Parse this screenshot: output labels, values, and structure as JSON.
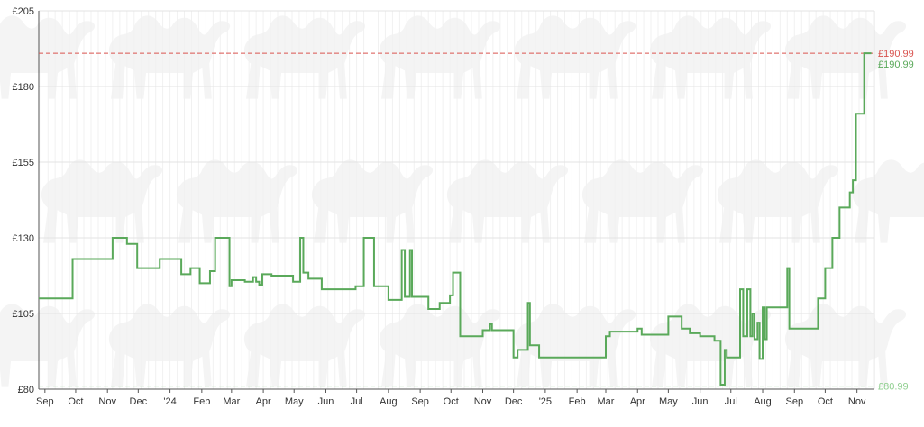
{
  "colors": {
    "series": "#5aa95a",
    "high_ref": "#d9534f",
    "low_ref": "#8fcf8f",
    "grid": "#e3e3e3",
    "axis": "#555555",
    "watermark": "#f4f4f4"
  },
  "watermark_icon": "camel-icon",
  "chart_data": {
    "type": "line",
    "title": "",
    "xlabel": "",
    "ylabel": "",
    "ylim": [
      80,
      205
    ],
    "xlim": [
      "2023-08-26",
      "2025-11-18"
    ],
    "grid": true,
    "legend": "none",
    "y_ticks": [
      {
        "value": 80,
        "label": "£80"
      },
      {
        "value": 105,
        "label": "£105"
      },
      {
        "value": 130,
        "label": "£130"
      },
      {
        "value": 155,
        "label": "£155"
      },
      {
        "value": 180,
        "label": "£180"
      },
      {
        "value": 205,
        "label": "£205"
      }
    ],
    "x_ticks": [
      {
        "date": "2023-09-01",
        "label": "Sep"
      },
      {
        "date": "2023-10-01",
        "label": "Oct"
      },
      {
        "date": "2023-11-01",
        "label": "Nov"
      },
      {
        "date": "2023-12-01",
        "label": "Dec"
      },
      {
        "date": "2024-01-01",
        "label": "'24"
      },
      {
        "date": "2024-02-01",
        "label": "Feb"
      },
      {
        "date": "2024-03-01",
        "label": "Mar"
      },
      {
        "date": "2024-04-01",
        "label": "Apr"
      },
      {
        "date": "2024-05-01",
        "label": "May"
      },
      {
        "date": "2024-06-01",
        "label": "Jun"
      },
      {
        "date": "2024-07-01",
        "label": "Jul"
      },
      {
        "date": "2024-08-01",
        "label": "Aug"
      },
      {
        "date": "2024-09-01",
        "label": "Sep"
      },
      {
        "date": "2024-10-01",
        "label": "Oct"
      },
      {
        "date": "2024-11-01",
        "label": "Nov"
      },
      {
        "date": "2024-12-01",
        "label": "Dec"
      },
      {
        "date": "2025-01-01",
        "label": "'25"
      },
      {
        "date": "2025-02-01",
        "label": "Feb"
      },
      {
        "date": "2025-03-01",
        "label": "Mar"
      },
      {
        "date": "2025-04-01",
        "label": "Apr"
      },
      {
        "date": "2025-05-01",
        "label": "May"
      },
      {
        "date": "2025-06-01",
        "label": "Jun"
      },
      {
        "date": "2025-07-01",
        "label": "Jul"
      },
      {
        "date": "2025-08-01",
        "label": "Aug"
      },
      {
        "date": "2025-09-01",
        "label": "Sep"
      },
      {
        "date": "2025-10-01",
        "label": "Oct"
      },
      {
        "date": "2025-11-01",
        "label": "Nov"
      }
    ],
    "reference_lines": [
      {
        "value": 190.99,
        "label": "£190.99",
        "color": "#d9534f",
        "style": "dashed"
      },
      {
        "value": 80.99,
        "label": "£80.99",
        "color": "#8fcf8f",
        "style": "dashed"
      }
    ],
    "current_label": {
      "value": 190.99,
      "label": "£190.99",
      "color": "#5aa95a"
    },
    "series": [
      {
        "step": true,
        "points": [
          [
            "2023-08-26",
            110
          ],
          [
            "2023-09-28",
            110
          ],
          [
            "2023-09-28",
            123
          ],
          [
            "2023-11-06",
            123
          ],
          [
            "2023-11-06",
            130
          ],
          [
            "2023-11-20",
            130
          ],
          [
            "2023-11-20",
            128
          ],
          [
            "2023-11-30",
            128
          ],
          [
            "2023-11-30",
            120
          ],
          [
            "2023-12-22",
            120
          ],
          [
            "2023-12-22",
            123
          ],
          [
            "2024-01-12",
            123
          ],
          [
            "2024-01-12",
            118
          ],
          [
            "2024-01-21",
            118
          ],
          [
            "2024-01-21",
            120
          ],
          [
            "2024-01-30",
            120
          ],
          [
            "2024-01-30",
            115
          ],
          [
            "2024-02-09",
            115
          ],
          [
            "2024-02-09",
            119
          ],
          [
            "2024-02-14",
            119
          ],
          [
            "2024-02-14",
            130
          ],
          [
            "2024-02-28",
            130
          ],
          [
            "2024-02-28",
            114
          ],
          [
            "2024-03-01",
            114
          ],
          [
            "2024-03-01",
            116
          ],
          [
            "2024-03-14",
            116
          ],
          [
            "2024-03-14",
            115.5
          ],
          [
            "2024-03-22",
            115.5
          ],
          [
            "2024-03-22",
            117
          ],
          [
            "2024-03-25",
            117
          ],
          [
            "2024-03-25",
            115.5
          ],
          [
            "2024-03-28",
            115.5
          ],
          [
            "2024-03-28",
            114.5
          ],
          [
            "2024-03-31",
            114.5
          ],
          [
            "2024-03-31",
            118
          ],
          [
            "2024-04-09",
            118
          ],
          [
            "2024-04-09",
            117.5
          ],
          [
            "2024-04-30",
            117.5
          ],
          [
            "2024-04-30",
            115.5
          ],
          [
            "2024-05-07",
            115.5
          ],
          [
            "2024-05-07",
            130
          ],
          [
            "2024-05-10",
            130
          ],
          [
            "2024-05-10",
            118.5
          ],
          [
            "2024-05-15",
            118.5
          ],
          [
            "2024-05-15",
            116.5
          ],
          [
            "2024-05-28",
            116.5
          ],
          [
            "2024-05-28",
            113
          ],
          [
            "2024-06-30",
            113
          ],
          [
            "2024-06-30",
            114
          ],
          [
            "2024-07-08",
            114
          ],
          [
            "2024-07-08",
            130
          ],
          [
            "2024-07-18",
            130
          ],
          [
            "2024-07-18",
            114
          ],
          [
            "2024-08-01",
            114
          ],
          [
            "2024-08-01",
            109.5
          ],
          [
            "2024-08-14",
            109.5
          ],
          [
            "2024-08-14",
            126
          ],
          [
            "2024-08-17",
            126
          ],
          [
            "2024-08-17",
            110.5
          ],
          [
            "2024-08-22",
            110.5
          ],
          [
            "2024-08-22",
            126
          ],
          [
            "2024-08-24",
            126
          ],
          [
            "2024-08-24",
            110.5
          ],
          [
            "2024-09-09",
            110.5
          ],
          [
            "2024-09-09",
            106.5
          ],
          [
            "2024-09-20",
            106.5
          ],
          [
            "2024-09-20",
            108.5
          ],
          [
            "2024-09-30",
            108.5
          ],
          [
            "2024-09-30",
            111
          ],
          [
            "2024-10-03",
            111
          ],
          [
            "2024-10-03",
            118.5
          ],
          [
            "2024-10-10",
            118.5
          ],
          [
            "2024-10-10",
            97.5
          ],
          [
            "2024-11-01",
            97.5
          ],
          [
            "2024-11-01",
            99.5
          ],
          [
            "2024-11-08",
            99.5
          ],
          [
            "2024-11-08",
            101.5
          ],
          [
            "2024-11-10",
            101.5
          ],
          [
            "2024-11-10",
            99.5
          ],
          [
            "2024-12-01",
            99.5
          ],
          [
            "2024-12-01",
            90.5
          ],
          [
            "2024-12-05",
            90.5
          ],
          [
            "2024-12-05",
            93
          ],
          [
            "2024-12-15",
            93
          ],
          [
            "2024-12-15",
            108.5
          ],
          [
            "2024-12-17",
            108.5
          ],
          [
            "2024-12-17",
            94.5
          ],
          [
            "2024-12-26",
            94.5
          ],
          [
            "2024-12-26",
            90.5
          ],
          [
            "2025-03-01",
            90.5
          ],
          [
            "2025-03-01",
            97.5
          ],
          [
            "2025-03-05",
            97.5
          ],
          [
            "2025-03-05",
            99
          ],
          [
            "2025-04-01",
            99
          ],
          [
            "2025-04-01",
            100
          ],
          [
            "2025-04-05",
            100
          ],
          [
            "2025-04-05",
            98
          ],
          [
            "2025-05-01",
            98
          ],
          [
            "2025-05-01",
            104
          ],
          [
            "2025-05-14",
            104
          ],
          [
            "2025-05-14",
            100
          ],
          [
            "2025-05-22",
            100
          ],
          [
            "2025-05-22",
            98.5
          ],
          [
            "2025-06-01",
            98.5
          ],
          [
            "2025-06-01",
            97.5
          ],
          [
            "2025-06-15",
            97.5
          ],
          [
            "2025-06-15",
            96
          ],
          [
            "2025-06-21",
            96
          ],
          [
            "2025-06-21",
            81.5
          ],
          [
            "2025-06-25",
            81.5
          ],
          [
            "2025-06-25",
            93
          ],
          [
            "2025-06-27",
            93
          ],
          [
            "2025-06-27",
            90.5
          ],
          [
            "2025-07-10",
            90.5
          ],
          [
            "2025-07-10",
            113
          ],
          [
            "2025-07-13",
            113
          ],
          [
            "2025-07-13",
            97.5
          ],
          [
            "2025-07-17",
            97.5
          ],
          [
            "2025-07-17",
            113
          ],
          [
            "2025-07-20",
            113
          ],
          [
            "2025-07-20",
            97.5
          ],
          [
            "2025-07-22",
            97.5
          ],
          [
            "2025-07-22",
            105
          ],
          [
            "2025-07-24",
            105
          ],
          [
            "2025-07-24",
            96.5
          ],
          [
            "2025-07-27",
            96.5
          ],
          [
            "2025-07-27",
            102
          ],
          [
            "2025-07-29",
            102
          ],
          [
            "2025-07-29",
            90
          ],
          [
            "2025-08-01",
            90
          ],
          [
            "2025-08-01",
            107
          ],
          [
            "2025-08-03",
            107
          ],
          [
            "2025-08-03",
            96.5
          ],
          [
            "2025-08-05",
            96.5
          ],
          [
            "2025-08-05",
            107
          ],
          [
            "2025-08-25",
            107
          ],
          [
            "2025-08-25",
            120
          ],
          [
            "2025-08-27",
            120
          ],
          [
            "2025-08-27",
            100
          ],
          [
            "2025-09-24",
            100
          ],
          [
            "2025-09-24",
            110
          ],
          [
            "2025-10-01",
            110
          ],
          [
            "2025-10-01",
            120
          ],
          [
            "2025-10-08",
            120
          ],
          [
            "2025-10-08",
            130
          ],
          [
            "2025-10-15",
            130
          ],
          [
            "2025-10-15",
            140
          ],
          [
            "2025-10-25",
            140
          ],
          [
            "2025-10-25",
            145
          ],
          [
            "2025-10-28",
            145
          ],
          [
            "2025-10-28",
            149
          ],
          [
            "2025-10-31",
            149
          ],
          [
            "2025-10-31",
            171
          ],
          [
            "2025-11-08",
            171
          ],
          [
            "2025-11-08",
            190.99
          ],
          [
            "2025-11-15",
            190.99
          ]
        ]
      }
    ]
  }
}
